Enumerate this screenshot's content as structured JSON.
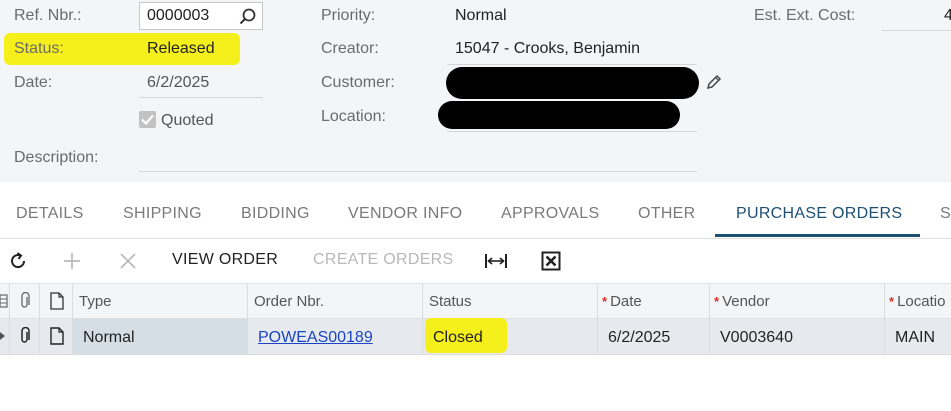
{
  "form": {
    "ref_nbr_label": "Ref. Nbr.:",
    "ref_nbr_value": "0000003",
    "status_label": "Status:",
    "status_value": "Released",
    "date_label": "Date:",
    "date_value": "6/2/2025",
    "quoted_label": "Quoted",
    "quoted_checked": true,
    "description_label": "Description:",
    "description_value": "",
    "priority_label": "Priority:",
    "priority_value": "Normal",
    "creator_label": "Creator:",
    "creator_value": "15047 - Crooks, Benjamin",
    "customer_label": "Customer:",
    "location_label": "Location:",
    "est_ext_cost_label": "Est. Ext. Cost:",
    "est_ext_cost_value": "4"
  },
  "tabs": [
    "DETAILS",
    "SHIPPING",
    "BIDDING",
    "VENDOR INFO",
    "APPROVALS",
    "OTHER",
    "PURCHASE ORDERS",
    "S"
  ],
  "active_tab": "PURCHASE ORDERS",
  "toolbar": {
    "view_order": "VIEW ORDER",
    "create_orders": "CREATE ORDERS"
  },
  "grid": {
    "columns": [
      "Type",
      "Order Nbr.",
      "Status",
      "Date",
      "Vendor",
      "Locatio"
    ],
    "required": [
      false,
      false,
      false,
      true,
      true,
      true
    ],
    "rows": [
      {
        "type": "Normal",
        "order_nbr": "POWEAS00189",
        "status": "Closed",
        "date": "6/2/2025",
        "vendor": "V0003640",
        "location": "MAIN"
      }
    ]
  },
  "colors": {
    "highlight": "#f5f01c",
    "accent": "#1c4f73",
    "link": "#1a44c4",
    "required": "#d0312d"
  }
}
